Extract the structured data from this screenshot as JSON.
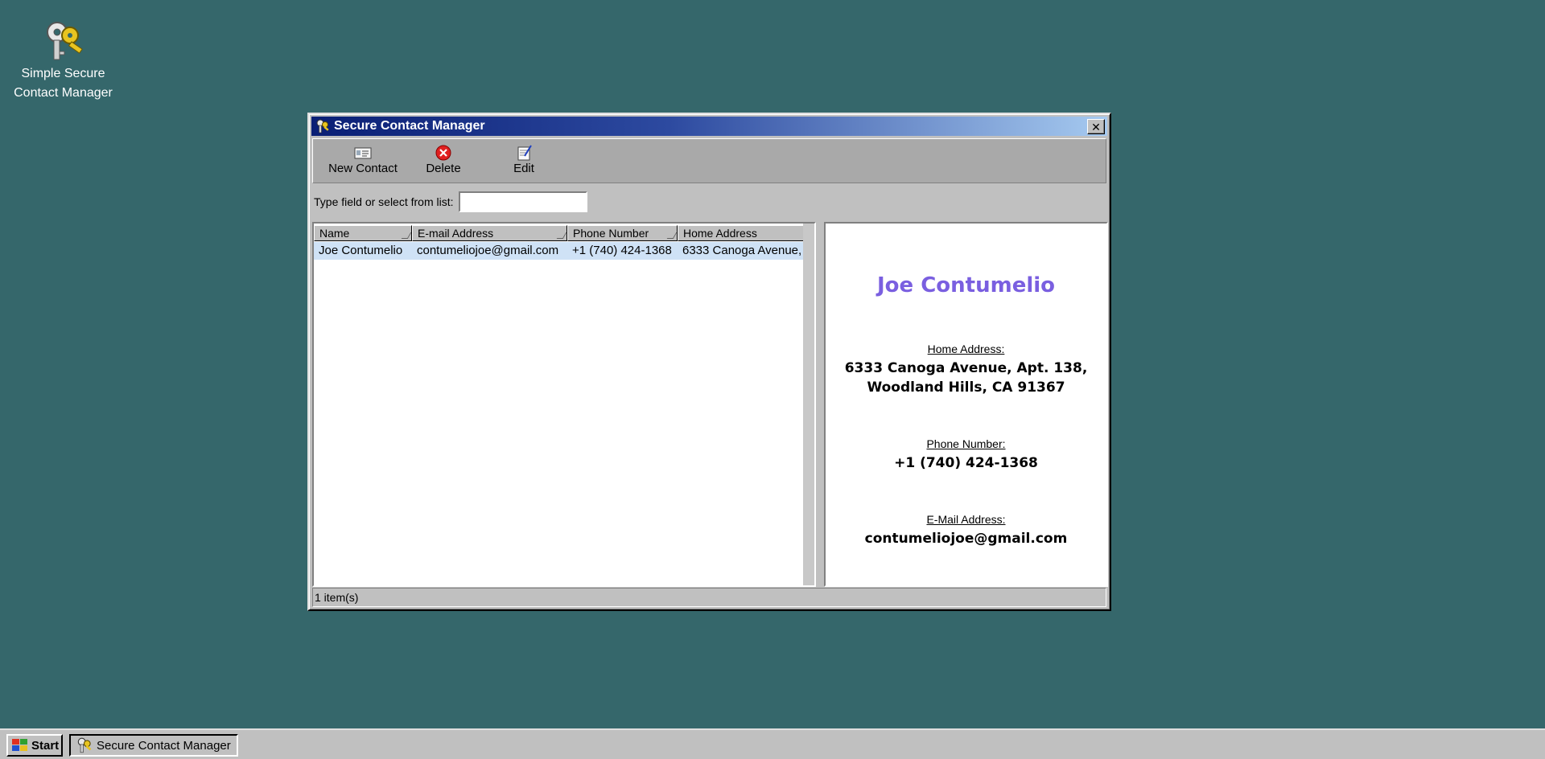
{
  "desktop": {
    "icon": {
      "name": "keys-icon",
      "label": "Simple Secure\nContact Manager",
      "label_line1": "Simple Secure",
      "label_line2": "Contact Manager"
    }
  },
  "window": {
    "title": "Secure Contact Manager",
    "close_symbol": "✕",
    "toolbar": {
      "new_contact": "New Contact",
      "delete": "Delete",
      "edit": "Edit"
    },
    "search": {
      "label": "Type field or select from list:",
      "value": ""
    },
    "list": {
      "columns": [
        "Name",
        "E-mail Address",
        "Phone Number",
        "Home Address"
      ],
      "rows": [
        {
          "name": "Joe Contumelio",
          "email": "contumeliojoe@gmail.com",
          "phone": "+1 (740) 424-1368",
          "address": "6333 Canoga Avenue,"
        }
      ]
    },
    "detail": {
      "name": "Joe Contumelio",
      "home_address_label": "Home Address:",
      "home_address_line1": "6333 Canoga Avenue, Apt. 138,",
      "home_address_line2": "Woodland Hills, CA 91367",
      "phone_label": "Phone Number:",
      "phone": "+1 (740) 424-1368",
      "email_label": "E-Mail Address:",
      "email": "contumeliojoe@gmail.com"
    },
    "status": "1 item(s)"
  },
  "taskbar": {
    "start_label": "Start",
    "task_label": "Secure Contact Manager"
  },
  "colors": {
    "desktop": "#35676b",
    "title_gradient_start": "#0a1f75",
    "contact_name": "#7a5fe0",
    "selected_row": "#cfe2f6"
  }
}
